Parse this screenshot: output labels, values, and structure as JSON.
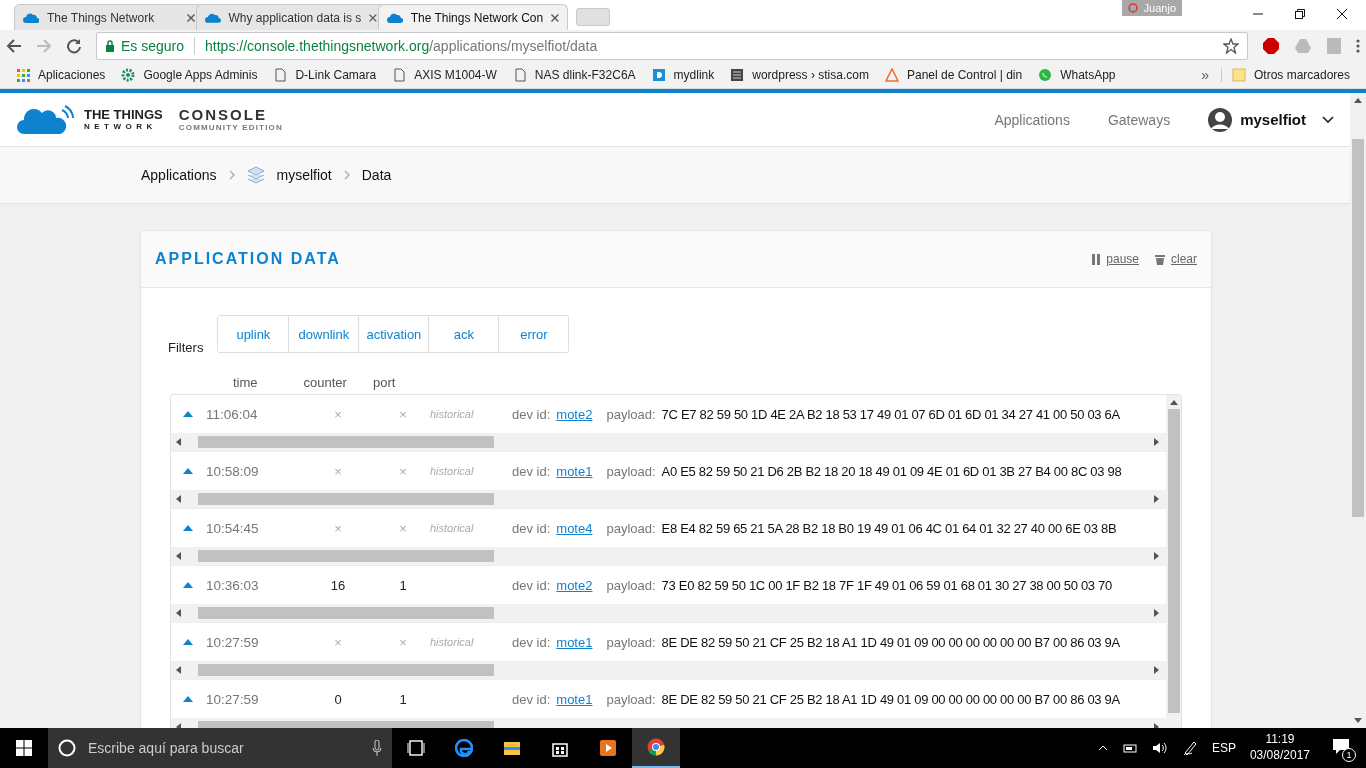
{
  "browser": {
    "tabs": [
      {
        "title": "The Things Network",
        "selected": false
      },
      {
        "title": "Why application data is s",
        "selected": false
      },
      {
        "title": "The Things Network Con",
        "selected": true
      }
    ],
    "profile": "Juanjo",
    "security": "Es seguro",
    "url_host": "https://console.thethingsnetwork.org",
    "url_path": "/applications/myselfiot/data",
    "bookmarks": [
      {
        "label": "Aplicaciones",
        "kind": "apps"
      },
      {
        "label": "Google Apps Adminis",
        "kind": "gear"
      },
      {
        "label": "D-Link Camara",
        "kind": "page"
      },
      {
        "label": "AXIS M1004-W",
        "kind": "page"
      },
      {
        "label": "NAS dlink-F32C6A",
        "kind": "page"
      },
      {
        "label": "mydlink",
        "kind": "dlink"
      },
      {
        "label": "wordpress › stisa.com",
        "kind": "wordpress"
      },
      {
        "label": "Panel de Control | din",
        "kind": "triangle"
      },
      {
        "label": "WhatsApp",
        "kind": "whatsapp"
      }
    ],
    "bookmarks_more": "»",
    "other_bookmarks": "Otros marcadores"
  },
  "header": {
    "brand_line1": "THE THINGS",
    "brand_line2": "NETWORK",
    "product": "CONSOLE",
    "edition": "COMMUNITY EDITION",
    "nav": [
      "Applications",
      "Gateways"
    ],
    "user": "myselfiot"
  },
  "breadcrumb": [
    {
      "label": "Applications",
      "kind": "link"
    },
    {
      "label": "myselfiot",
      "kind": "app"
    },
    {
      "label": "Data",
      "kind": "current"
    }
  ],
  "card": {
    "title": "APPLICATION DATA",
    "actions": [
      {
        "label": "pause",
        "kind": "pause"
      },
      {
        "label": "clear",
        "kind": "clear"
      }
    ],
    "filters_label": "Filters",
    "filters": [
      "uplink",
      "downlink",
      "activation",
      "ack",
      "error"
    ],
    "columns": [
      "time",
      "counter",
      "port"
    ],
    "rows": [
      {
        "time": "11:06:04",
        "counter": "×",
        "port": "×",
        "tag": "historical",
        "dev_id_label": "dev id:",
        "dev_id": "mote2",
        "payload_label": "payload:",
        "payload": "7C E7 82 59 50 1D 4E 2A B2 18 53 17 49 01 07 6D 01 6D 01 34 27 41 00 50 03 6A"
      },
      {
        "time": "10:58:09",
        "counter": "×",
        "port": "×",
        "tag": "historical",
        "dev_id_label": "dev id:",
        "dev_id": "mote1",
        "payload_label": "payload:",
        "payload": "A0 E5 82 59 50 21 D6 2B B2 18 20 18 49 01 09 4E 01 6D 01 3B 27 B4 00 8C 03 98"
      },
      {
        "time": "10:54:45",
        "counter": "×",
        "port": "×",
        "tag": "historical",
        "dev_id_label": "dev id:",
        "dev_id": "mote4",
        "payload_label": "payload:",
        "payload": "E8 E4 82 59 65 21 5A 28 B2 18 B0 19 49 01 06 4C 01 64 01 32 27 40 00 6E 03 8B"
      },
      {
        "time": "10:36:03",
        "counter": "16",
        "port": "1",
        "dev_id_label": "dev id:",
        "dev_id": "mote2",
        "payload_label": "payload:",
        "payload": "73 E0 82 59 50 1C 00 1F B2 18 7F 1F 49 01 06 59 01 68 01 30 27 38 00 50 03 70"
      },
      {
        "time": "10:27:59",
        "counter": "×",
        "port": "×",
        "tag": "historical",
        "dev_id_label": "dev id:",
        "dev_id": "mote1",
        "payload_label": "payload:",
        "payload": "8E DE 82 59 50 21 CF 25 B2 18 A1 1D 49 01 09 00 00 00 00 00 00 B7 00 86 03 9A"
      },
      {
        "time": "10:27:59",
        "counter": "0",
        "port": "1",
        "dev_id_label": "dev id:",
        "dev_id": "mote1",
        "payload_label": "payload:",
        "payload": "8E DE 82 59 50 21 CF 25 B2 18 A1 1D 49 01 09 00 00 00 00 00 00 B7 00 86 03 9A"
      }
    ]
  },
  "taskbar": {
    "search_placeholder": "Escribe aquí para buscar",
    "language": "ESP",
    "time": "11:19",
    "date": "03/08/2017",
    "notifications": "1"
  }
}
